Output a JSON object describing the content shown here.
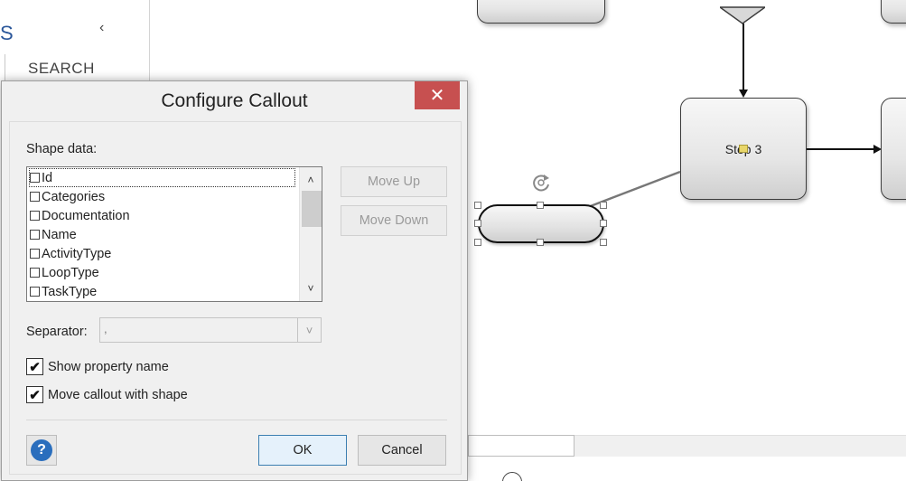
{
  "left_pane": {
    "brand_glyph": "S",
    "collapse_glyph": "‹",
    "search_label": "SEARCH"
  },
  "canvas": {
    "shapes": {
      "step3_label": "Step 3"
    },
    "icons": {
      "rotate_handle": "rotate-icon",
      "zoom": "zoom-icon"
    }
  },
  "dialog": {
    "title": "Configure Callout",
    "close_glyph": "✕",
    "shape_data_label": "Shape data:",
    "shape_data_items": [
      {
        "label": "Id",
        "checked": false
      },
      {
        "label": "Categories",
        "checked": false
      },
      {
        "label": "Documentation",
        "checked": false
      },
      {
        "label": "Name",
        "checked": false
      },
      {
        "label": "ActivityType",
        "checked": false
      },
      {
        "label": "LoopType",
        "checked": false
      },
      {
        "label": "TaskType",
        "checked": false
      }
    ],
    "move_up_label": "Move Up",
    "move_down_label": "Move Down",
    "separator_label": "Separator:",
    "separator_value": ",",
    "show_property_name_label": "Show property name",
    "show_property_name_checked": true,
    "move_callout_label": "Move callout with shape",
    "move_callout_checked": true,
    "ok_label": "OK",
    "cancel_label": "Cancel",
    "help_glyph": "?"
  },
  "colors": {
    "close_button": "#c75050",
    "help_icon": "#2a6ebd",
    "ok_border": "#3c7fb1"
  }
}
